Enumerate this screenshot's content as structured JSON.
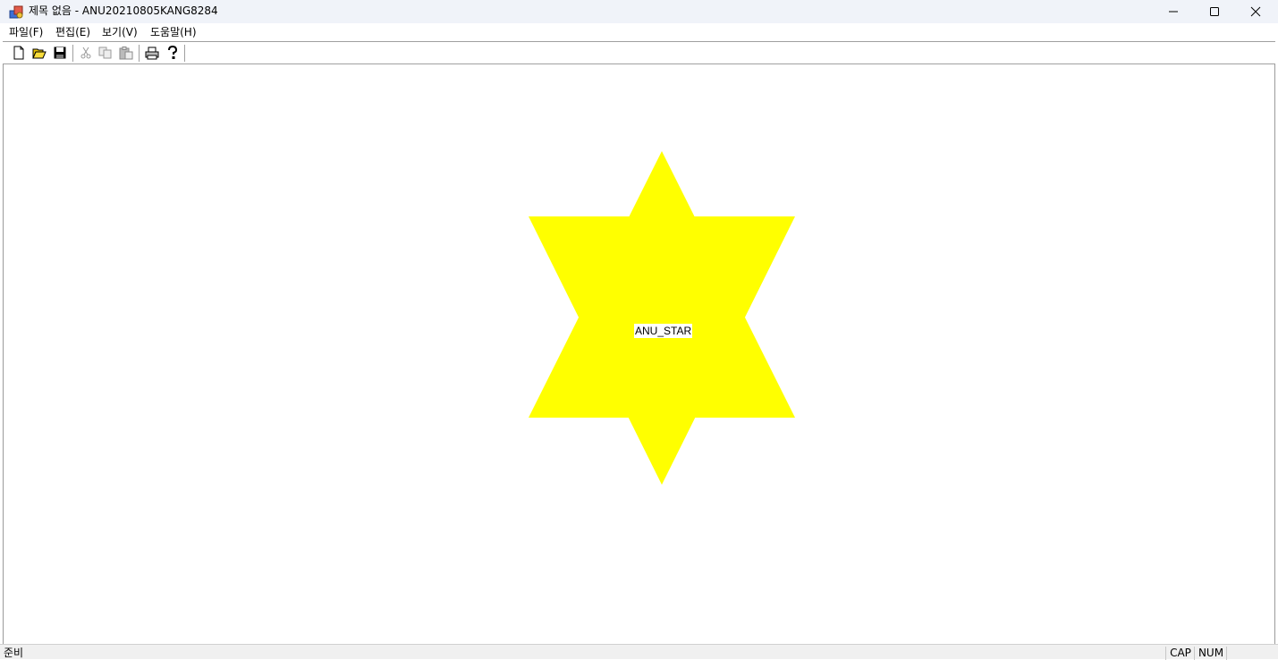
{
  "window": {
    "title": "제목 없음 - ANU20210805KANG8284"
  },
  "menu": {
    "items": [
      "파일(F)",
      "편집(E)",
      "보기(V)",
      "도움말(H)"
    ]
  },
  "toolbar": {
    "buttons": [
      "new-icon",
      "open-icon",
      "save-icon",
      "cut-icon",
      "copy-icon",
      "paste-icon",
      "print-icon",
      "help-icon"
    ]
  },
  "canvas": {
    "shape": "six-pointed-star",
    "fill": "#ffff00",
    "label": "ANU_STAR"
  },
  "status": {
    "text": "준비",
    "indicators": [
      "CAP",
      "NUM",
      ""
    ]
  }
}
